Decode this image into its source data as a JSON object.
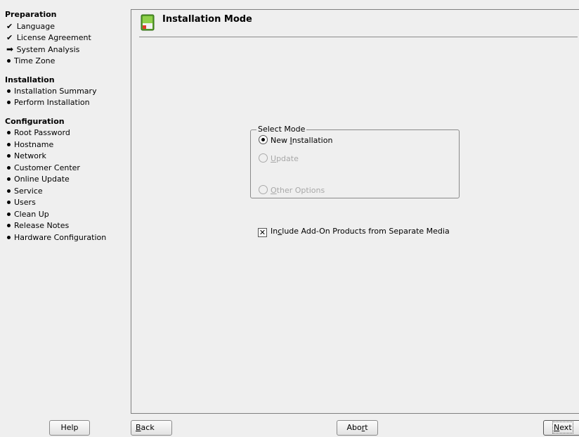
{
  "sidebar": {
    "sections": [
      {
        "title": "Preparation",
        "items": [
          {
            "label": "Language",
            "status": "done"
          },
          {
            "label": "License Agreement",
            "status": "done"
          },
          {
            "label": "System Analysis",
            "status": "current"
          },
          {
            "label": "Time Zone",
            "status": "pending"
          }
        ]
      },
      {
        "title": "Installation",
        "items": [
          {
            "label": "Installation Summary",
            "status": "pending"
          },
          {
            "label": "Perform Installation",
            "status": "pending"
          }
        ]
      },
      {
        "title": "Configuration",
        "items": [
          {
            "label": "Root Password",
            "status": "pending"
          },
          {
            "label": "Hostname",
            "status": "pending"
          },
          {
            "label": "Network",
            "status": "pending"
          },
          {
            "label": "Customer Center",
            "status": "pending"
          },
          {
            "label": "Online Update",
            "status": "pending"
          },
          {
            "label": "Service",
            "status": "pending"
          },
          {
            "label": "Users",
            "status": "pending"
          },
          {
            "label": "Clean Up",
            "status": "pending"
          },
          {
            "label": "Release Notes",
            "status": "pending"
          },
          {
            "label": "Hardware Configuration",
            "status": "pending"
          }
        ]
      }
    ]
  },
  "header": {
    "title": "Installation Mode",
    "icon": "installation-mode-icon"
  },
  "select_mode": {
    "title": "Select Mode",
    "options": [
      {
        "pre": "New ",
        "u": "I",
        "post": "nstallation",
        "selected": true,
        "enabled": true
      },
      {
        "pre": "",
        "u": "U",
        "post": "pdate",
        "selected": false,
        "enabled": false
      },
      {
        "pre": "",
        "u": "O",
        "post": "ther Options",
        "selected": false,
        "enabled": false
      }
    ]
  },
  "addon": {
    "pre": "In",
    "u": "c",
    "post": "lude Add-On Products from Separate Media",
    "checked": true
  },
  "buttons": {
    "help": "Help",
    "back_u": "B",
    "back_rest": "ack",
    "abort_pre": "Abo",
    "abort_u": "r",
    "abort_post": "t",
    "next_u": "N",
    "next_rest": "ext"
  }
}
